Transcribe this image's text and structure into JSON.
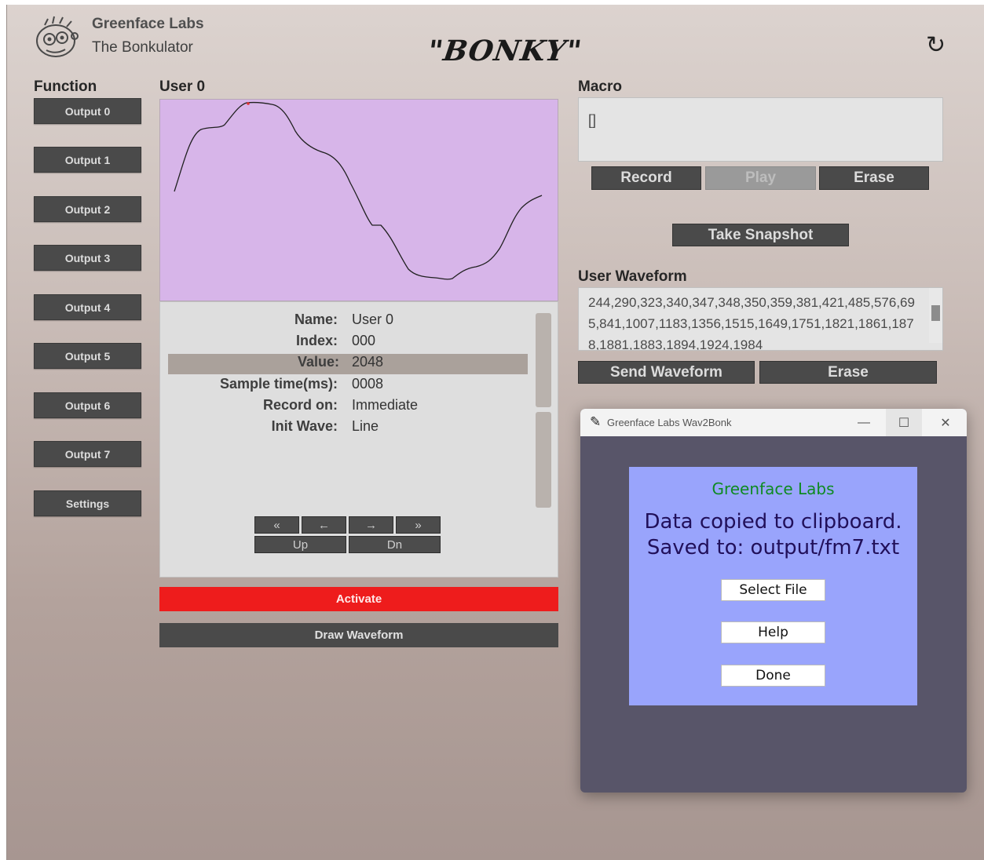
{
  "header": {
    "brand_name": "Greenface Labs",
    "app_name": "The Bonkulator",
    "title": "\"BONKY\"",
    "refresh_icon": "refresh-icon"
  },
  "function": {
    "heading": "Function",
    "buttons": [
      "Output 0",
      "Output 1",
      "Output 2",
      "Output 3",
      "Output 4",
      "Output 5",
      "Output 6",
      "Output 7",
      "Settings"
    ]
  },
  "user": {
    "heading": "User 0",
    "fields": [
      {
        "label": "Name:",
        "value": "User 0"
      },
      {
        "label": "Index:",
        "value": "000"
      },
      {
        "label": "Value:",
        "value": "2048"
      },
      {
        "label": "Sample time(ms):",
        "value": "0008"
      },
      {
        "label": "Record on:",
        "value": "Immediate"
      },
      {
        "label": "Init Wave:",
        "value": "Line"
      }
    ],
    "selected_field": "Value:",
    "nav": {
      "first": "«",
      "prev": "←",
      "next": "→",
      "last": "»",
      "up": "Up",
      "down": "Dn"
    },
    "activate_label": "Activate",
    "draw_label": "Draw Waveform",
    "activate_color": "#ee1c1c",
    "graph_color": "#d7b5e9"
  },
  "macro": {
    "heading": "Macro",
    "text": "[]",
    "record_label": "Record",
    "play_label": "Play",
    "erase_label": "Erase",
    "snapshot_label": "Take Snapshot"
  },
  "user_waveform": {
    "heading": "User Waveform",
    "text": "244,290,323,340,347,348,350,359,381,421,485,576,695,841,1007,1183,1356,1515,1649,1751,1821,1861,1878,1881,1883,1894,1924,1984",
    "send_label": "Send Waveform",
    "erase_label": "Erase"
  },
  "dialog": {
    "title": "Greenface Labs Wav2Bonk",
    "brand": "Greenface Labs",
    "message_line1": "Data copied to clipboard.",
    "message_line2": "Saved to: output/fm7.txt",
    "select_label": "Select File",
    "help_label": "Help",
    "done_label": "Done",
    "minimize": "—",
    "maximize": "☐",
    "close": "✕",
    "panel_color": "#99a4fc"
  }
}
